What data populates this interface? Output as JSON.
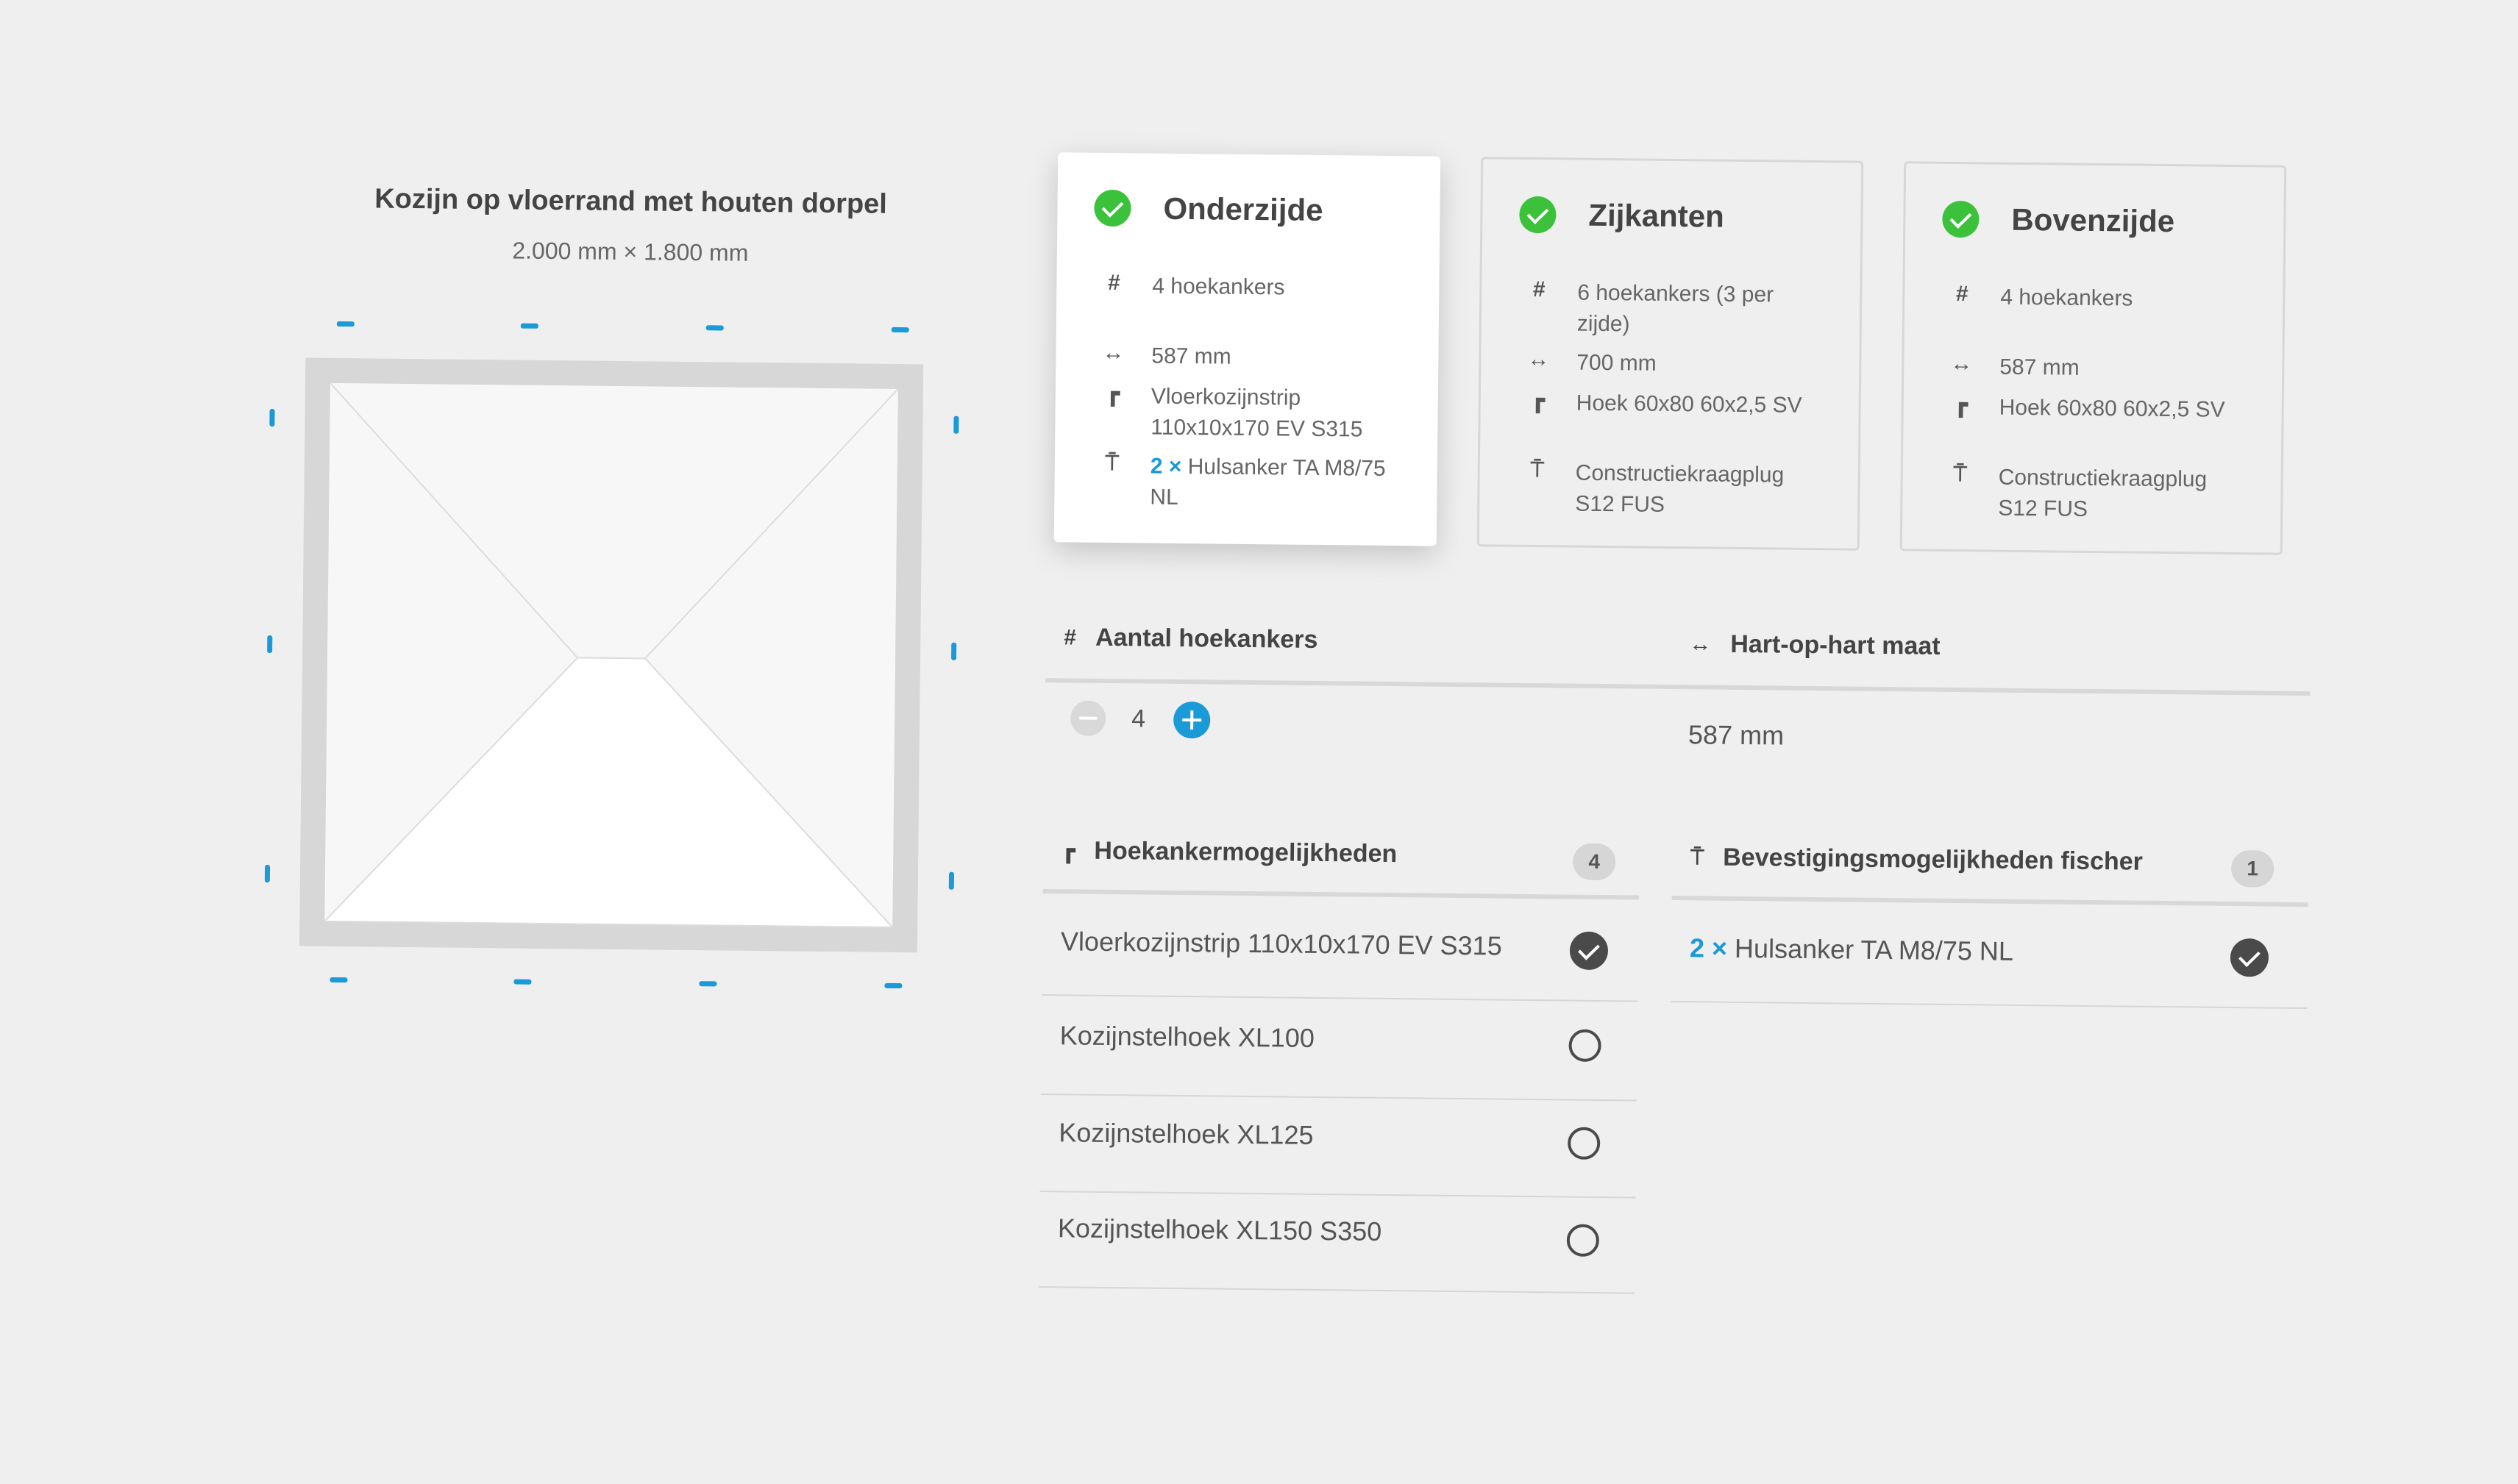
{
  "frame": {
    "title": "Kozijn op vloerrand met houten dorpel",
    "dimensions": "2.000 mm × 1.800 mm"
  },
  "cards": [
    {
      "title": "Onderzijde",
      "count": "4 hoekankers",
      "distance": "587 mm",
      "anchor": "Vloerkozijnstrip 110x10x170 EV S315",
      "fixing_qty": "2 ×",
      "fixing": "Hulsanker TA M8/75 NL"
    },
    {
      "title": "Zijkanten",
      "count": "6 hoekankers (3 per zijde)",
      "distance": "700 mm",
      "anchor": "Hoek 60x80 60x2,5 SV",
      "fixing": "Constructiekraagplug S12 FUS"
    },
    {
      "title": "Bovenzijde",
      "count": "4 hoekankers",
      "distance": "587 mm",
      "anchor": "Hoek 60x80 60x2,5 SV",
      "fixing": "Constructiekraagplug S12 FUS"
    }
  ],
  "settings": {
    "count_header": "Aantal hoekankers",
    "count_value": "4",
    "distance_header": "Hart-op-hart maat",
    "distance_value": "587 mm"
  },
  "anchor_options": {
    "header": "Hoekankermogelijkheden",
    "badge": "4",
    "items": [
      {
        "label": "Vloerkozijnstrip 110x10x170 EV S315",
        "selected": true
      },
      {
        "label": "Kozijnstelhoek XL100",
        "selected": false
      },
      {
        "label": "Kozijnstelhoek XL125",
        "selected": false
      },
      {
        "label": "Kozijnstelhoek XL150 S350",
        "selected": false
      }
    ]
  },
  "fixing_options": {
    "header": "Bevestigingsmogelijkheden fischer",
    "badge": "1",
    "items": [
      {
        "qty": "2 ×",
        "label": "Hulsanker TA M8/75 NL",
        "selected": true
      }
    ]
  },
  "icons": {
    "count": "hash-icon",
    "distance": "arrows-horizontal-icon",
    "anchor": "corner-bracket-icon",
    "fixing": "anchor-bolt-icon",
    "done": "check-circle-icon"
  },
  "colors": {
    "accent": "#1a9ad6",
    "success": "#3cc13b",
    "background": "#efefef"
  }
}
